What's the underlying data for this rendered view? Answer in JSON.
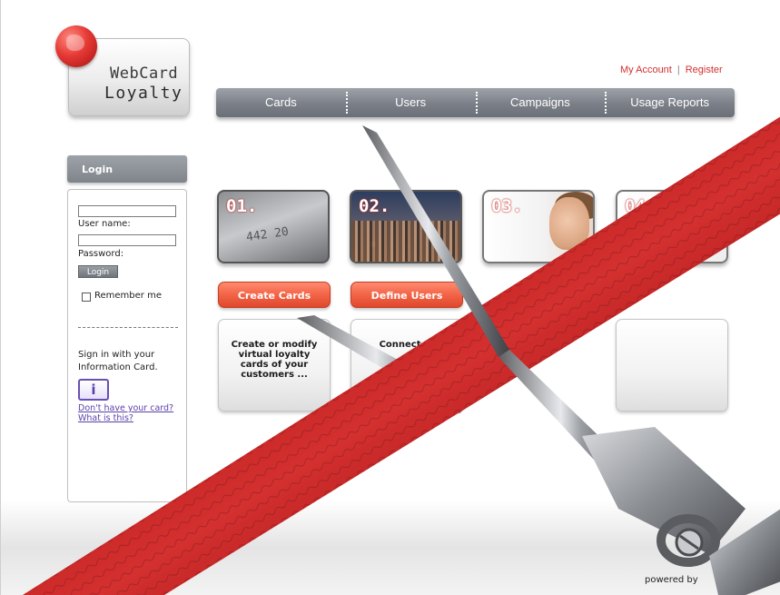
{
  "logo": {
    "line1": "WebCard",
    "line2": "Loyalty"
  },
  "header_links": {
    "my_account": "My Account",
    "separator": "|",
    "register": "Register"
  },
  "nav": {
    "items": [
      {
        "label": "Cards"
      },
      {
        "label": "Users"
      },
      {
        "label": "Campaigns"
      },
      {
        "label": "Usage Reports"
      }
    ]
  },
  "login": {
    "header": "Login",
    "username_label": "User name:",
    "password_label": "Password:",
    "button": "Login",
    "remember": "Remember me",
    "signin_text": "Sign in with your Information Card.",
    "infocard_icon": "i",
    "link1": "Don't have your card?",
    "link2": "What is this?"
  },
  "steps": [
    {
      "num": "01.",
      "card_digits": "442 20"
    },
    {
      "num": "02."
    },
    {
      "num": "03."
    },
    {
      "num": "04."
    }
  ],
  "actions": {
    "create_cards": "Create Cards",
    "define_users": "Define Users"
  },
  "descriptions": {
    "d1": "Create or modify virtual loyalty cards of your customers ...",
    "d2": "Connect ..."
  },
  "footer": {
    "powered": "powered by"
  },
  "colors": {
    "accent_red": "#e0482d",
    "nav_gray": "#7b8088",
    "ribbon_red": "#b11414",
    "link_purple": "#5b3fa8"
  }
}
